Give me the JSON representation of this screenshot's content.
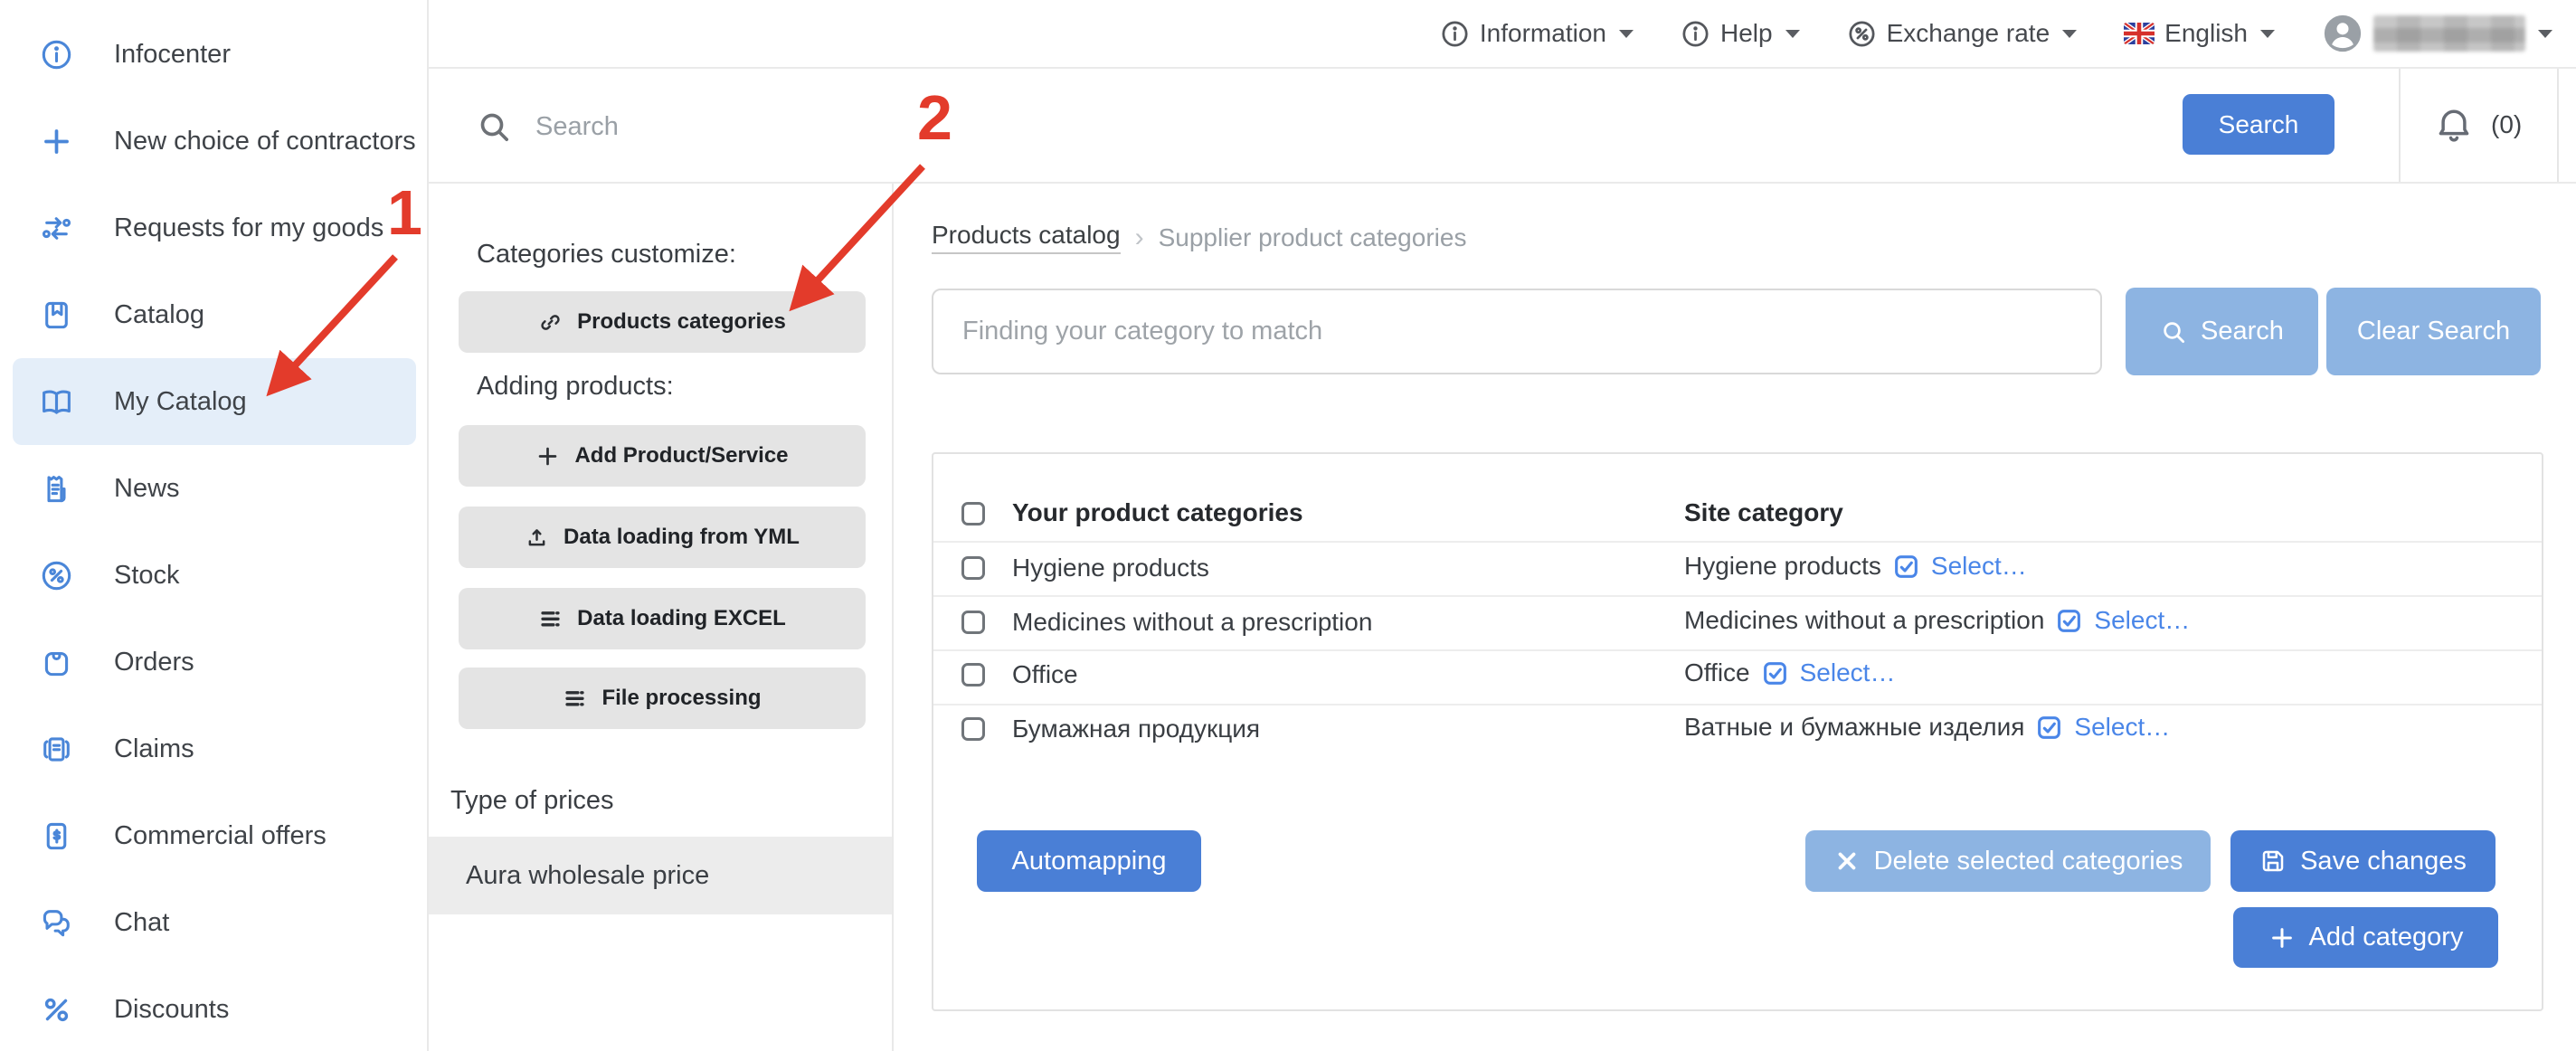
{
  "topbar": {
    "information": "Information",
    "help": "Help",
    "exchange_rate": "Exchange rate",
    "language": "English"
  },
  "header": {
    "search_placeholder": "Search",
    "search_button": "Search",
    "notifications_count": "(0)"
  },
  "sidebar": {
    "items": [
      {
        "label": "Infocenter",
        "icon": "info-icon"
      },
      {
        "label": "New choice of contractors",
        "icon": "plus-icon"
      },
      {
        "label": "Requests for my goods",
        "icon": "swap-icon"
      },
      {
        "label": "Catalog",
        "icon": "catalog-icon"
      },
      {
        "label": "My Catalog",
        "icon": "open-book-icon",
        "active": true
      },
      {
        "label": "News",
        "icon": "news-icon"
      },
      {
        "label": "Stock",
        "icon": "percent-circle-icon"
      },
      {
        "label": "Orders",
        "icon": "bag-icon"
      },
      {
        "label": "Claims",
        "icon": "claims-icon"
      },
      {
        "label": "Commercial offers",
        "icon": "offer-icon"
      },
      {
        "label": "Chat",
        "icon": "chat-icon"
      },
      {
        "label": "Discounts",
        "icon": "percent-icon"
      }
    ]
  },
  "tools_panel": {
    "categories_heading": "Categories customize:",
    "products_categories_button": "Products categories",
    "adding_heading": "Adding products:",
    "add_product_button": "Add Product/Service",
    "yml_button": "Data loading from YML",
    "excel_button": "Data loading EXCEL",
    "file_processing_button": "File processing",
    "price_type_heading": "Type of prices",
    "price_type_selected": "Aura wholesale price"
  },
  "main": {
    "breadcrumb": {
      "first": "Products catalog",
      "separator": "›",
      "second": "Supplier product categories"
    },
    "filter": {
      "placeholder": "Finding your category to match",
      "search_button": "Search",
      "clear_button": "Clear Search"
    },
    "table": {
      "columns": [
        "Your product categories",
        "Site category"
      ],
      "rows": [
        {
          "your_category": "Hygiene products",
          "site_category": "Hygiene products",
          "select_label": "Select…"
        },
        {
          "your_category": "Medicines without a prescription",
          "site_category": "Medicines without a prescription",
          "select_label": "Select…"
        },
        {
          "your_category": "Office",
          "site_category": "Office",
          "select_label": "Select…"
        },
        {
          "your_category": "Бумажная продукция",
          "site_category": "Ватные и бумажные изделия",
          "select_label": "Select…"
        }
      ]
    },
    "actions": {
      "automapping": "Automapping",
      "delete_selected": "Delete selected categories",
      "save_changes": "Save changes",
      "add_category": "Add category"
    }
  },
  "annotations": {
    "step1": "1",
    "step2": "2"
  },
  "colors": {
    "primary_blue": "#4a7fd6",
    "muted_blue": "#8db4e2",
    "link_blue": "#4a86e8",
    "sidebar_icon_blue": "#4a86d8",
    "active_item_bg": "#e4eef9",
    "gray_button": "#e4e4e4",
    "annotation_red": "#e33b2b"
  }
}
